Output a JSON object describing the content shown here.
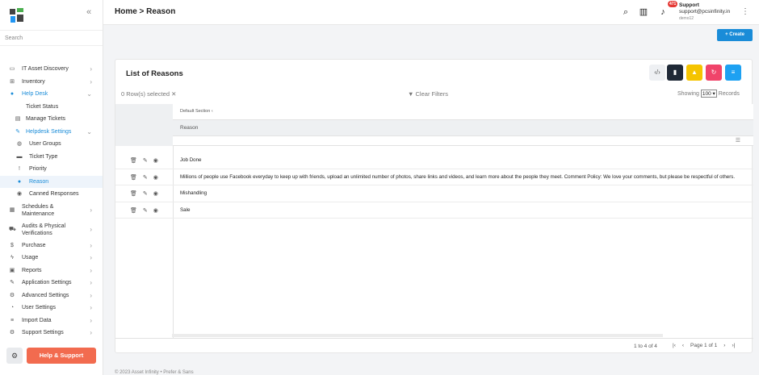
{
  "sidebar": {
    "search_placeholder": "Search",
    "items": [
      {
        "label": "IT Asset Discovery",
        "icon": "laptop-icon"
      },
      {
        "label": "Inventory",
        "icon": "sitemap-icon"
      },
      {
        "label": "Help Desk",
        "icon": "question-circle-icon"
      },
      {
        "label": "Ticket Status"
      },
      {
        "label": "Manage Tickets",
        "icon": "copy-icon"
      },
      {
        "label": "Helpdesk Settings",
        "icon": "wrench-icon"
      },
      {
        "label": "User Groups",
        "icon": "users-icon"
      },
      {
        "label": "Ticket Type",
        "icon": "ticket-icon"
      },
      {
        "label": "Priority",
        "icon": "exclamation-icon"
      },
      {
        "label": "Reason",
        "icon": "comment-icon"
      },
      {
        "label": "Canned Responses",
        "icon": "comments-icon"
      },
      {
        "label": "Schedules & Maintenance",
        "icon": "calendar-icon"
      },
      {
        "label": "Audits & Physical Verifications",
        "icon": "truck-icon"
      },
      {
        "label": "Purchase",
        "icon": "dollar-icon"
      },
      {
        "label": "Usage",
        "icon": "bolt-icon"
      },
      {
        "label": "Reports",
        "icon": "report-icon"
      },
      {
        "label": "Application Settings",
        "icon": "wrench-icon"
      },
      {
        "label": "Advanced Settings",
        "icon": "cogs-icon"
      },
      {
        "label": "User Settings",
        "icon": "user-cog-icon"
      },
      {
        "label": "Import Data",
        "icon": "database-icon"
      },
      {
        "label": "Support Settings",
        "icon": "cogs-icon"
      }
    ],
    "help_button": "Help & Support"
  },
  "header": {
    "breadcrumb": "Home > Reason",
    "notification_count": "471",
    "user_name": "Support",
    "user_email": "support@pcsinfinity.in",
    "user_tenant": "demo12"
  },
  "create_button": "Create",
  "card": {
    "title": "List of Reasons",
    "selected_info": "0 Row(s) selected",
    "clear_filters": "Clear Filters",
    "showing_label": "Showing",
    "showing_value": "100",
    "records_label": "Records",
    "section_label": "Default Section",
    "column_header": "Reason",
    "rows": [
      "Job Done",
      "Millions of people use Facebook everyday to keep up with friends, upload an unlimited number of photos, share links and videos, and learn more about the people they meet. Comment Policy: We love your comments, but please be respectful of others.",
      "Mishandling",
      "Sale"
    ],
    "record_count": "1 to 4 of 4",
    "page_info": "Page 1 of 1"
  },
  "footer": "© 2023 Asset Infinity • Prefer & Sans",
  "colors": {
    "accent": "#1a8cd8",
    "help": "#f26b4f",
    "dark_btn": "#1f2937",
    "yellow_btn": "#f5c400",
    "pink_btn": "#f0446a",
    "blue_btn": "#1da1f2"
  }
}
